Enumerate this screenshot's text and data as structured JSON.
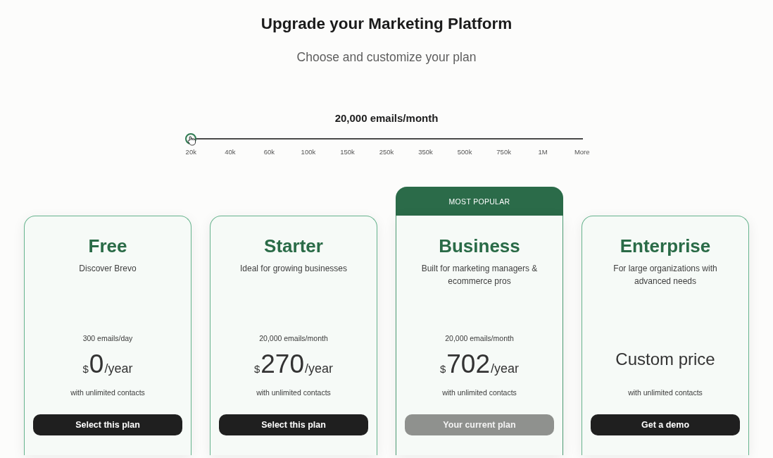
{
  "header": {
    "title": "Upgrade your Marketing Platform",
    "subtitle": "Choose and customize your plan"
  },
  "volume_slider": {
    "label": "20,000 emails/month",
    "level": 0,
    "ticks": [
      "20k",
      "40k",
      "60k",
      "100k",
      "150k",
      "250k",
      "350k",
      "500k",
      "750k",
      "1M",
      "More"
    ]
  },
  "plans": [
    {
      "name": "Free",
      "description": "Discover Brevo",
      "price": {
        "kind": "amount",
        "volume": "300 emails/day",
        "currency": "$",
        "amount": "0",
        "period": "/year"
      },
      "note": "with unlimited contacts",
      "button": {
        "label": "Select this plan",
        "disabled": false
      }
    },
    {
      "name": "Starter",
      "description": "Ideal for growing businesses",
      "price": {
        "kind": "amount",
        "volume": "20,000 emails/month",
        "currency": "$",
        "amount": "270",
        "period": "/year"
      },
      "note": "with unlimited contacts",
      "button": {
        "label": "Select this plan",
        "disabled": false
      }
    },
    {
      "name": "Business",
      "badge": "MOST POPULAR",
      "description": "Built for marketing managers & ecommerce pros",
      "price": {
        "kind": "amount",
        "volume": "20,000 emails/month",
        "currency": "$",
        "amount": "702",
        "period": "/year"
      },
      "note": "with unlimited contacts",
      "button": {
        "label": "Your current plan",
        "disabled": true
      }
    },
    {
      "name": "Enterprise",
      "description": "For large organizations with advanced needs",
      "price": {
        "kind": "custom",
        "text": "Custom price"
      },
      "note": "with unlimited contacts",
      "button": {
        "label": "Get a demo",
        "disabled": false
      }
    }
  ]
}
